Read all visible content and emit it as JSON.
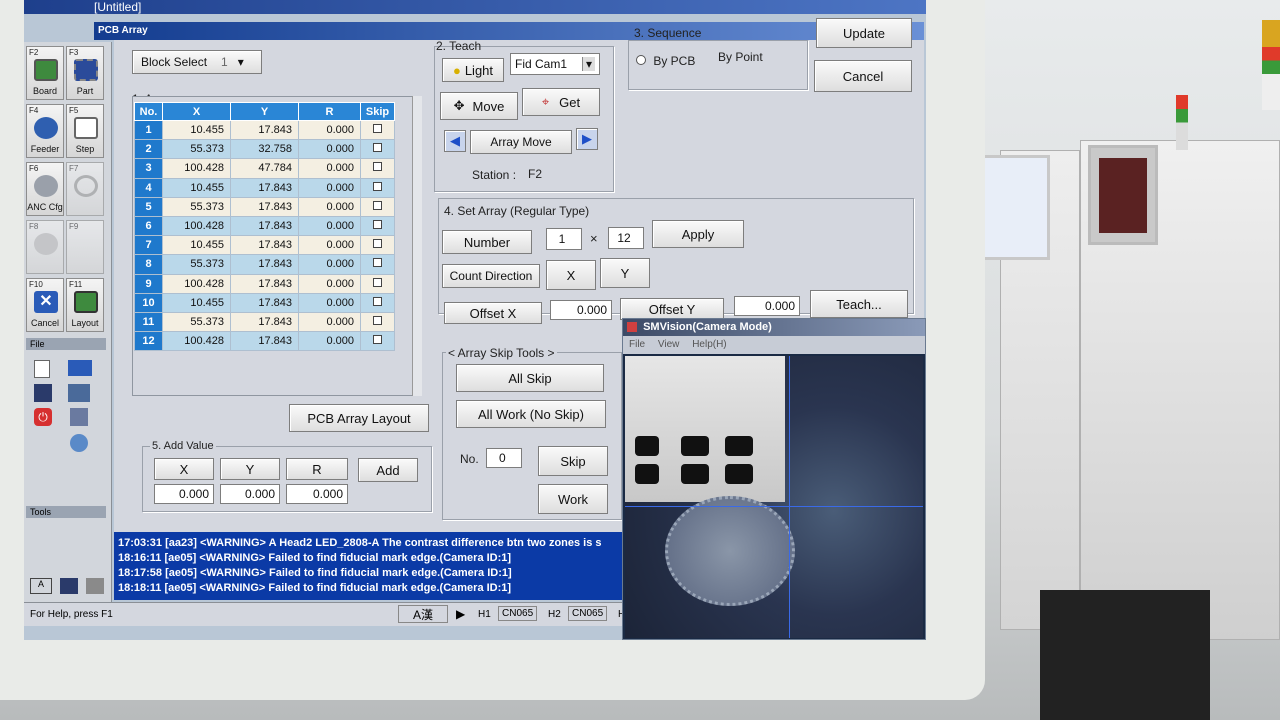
{
  "window": {
    "title": "[Untitled]",
    "dialog_title": "PCB Array"
  },
  "left_toolbar": {
    "buttons": [
      {
        "key": "F2",
        "label": "Board"
      },
      {
        "key": "F3",
        "label": "Part"
      },
      {
        "key": "F4",
        "label": "Feeder"
      },
      {
        "key": "F5",
        "label": "Step"
      },
      {
        "key": "F6",
        "label": "ANC Cfg"
      },
      {
        "key": "F7",
        "label": ""
      },
      {
        "key": "F8",
        "label": ""
      },
      {
        "key": "F9",
        "label": ""
      },
      {
        "key": "F10",
        "label": "Cancel"
      },
      {
        "key": "F11",
        "label": "Layout"
      }
    ],
    "file_header": "File",
    "tools_header": "Tools"
  },
  "array_section": {
    "block_select_label": "Block Select",
    "block_select_value": "1",
    "title": "1. Array",
    "columns": [
      "No.",
      "X",
      "Y",
      "R",
      "Skip"
    ],
    "rows": [
      {
        "no": "1",
        "x": "10.455",
        "y": "17.843",
        "r": "0.000"
      },
      {
        "no": "2",
        "x": "55.373",
        "y": "32.758",
        "r": "0.000"
      },
      {
        "no": "3",
        "x": "100.428",
        "y": "47.784",
        "r": "0.000"
      },
      {
        "no": "4",
        "x": "10.455",
        "y": "17.843",
        "r": "0.000"
      },
      {
        "no": "5",
        "x": "55.373",
        "y": "17.843",
        "r": "0.000"
      },
      {
        "no": "6",
        "x": "100.428",
        "y": "17.843",
        "r": "0.000"
      },
      {
        "no": "7",
        "x": "10.455",
        "y": "17.843",
        "r": "0.000"
      },
      {
        "no": "8",
        "x": "55.373",
        "y": "17.843",
        "r": "0.000"
      },
      {
        "no": "9",
        "x": "100.428",
        "y": "17.843",
        "r": "0.000"
      },
      {
        "no": "10",
        "x": "10.455",
        "y": "17.843",
        "r": "0.000"
      },
      {
        "no": "11",
        "x": "55.373",
        "y": "17.843",
        "r": "0.000"
      },
      {
        "no": "12",
        "x": "100.428",
        "y": "17.843",
        "r": "0.000"
      }
    ],
    "layout_button": "PCB Array Layout"
  },
  "teach": {
    "title": "2. Teach",
    "light_label": "Light",
    "camera_select": "Fid Cam1",
    "move_label": "Move",
    "get_label": "Get",
    "array_move_label": "Array Move",
    "station_label": "Station :",
    "station_value": "F2"
  },
  "sequence": {
    "title": "3. Sequence",
    "option1": "By PCB",
    "option2": "By Point",
    "update_label": "Update",
    "cancel_label": "Cancel"
  },
  "set_array": {
    "title": "4. Set Array (Regular Type)",
    "number_label": "Number",
    "number_x": "1",
    "times": "×",
    "number_y": "12",
    "apply_label": "Apply",
    "count_direction_label": "Count Direction",
    "dir_x": "X",
    "dir_y": "Y",
    "offset_x_label": "Offset X",
    "offset_x_value": "0.000",
    "offset_y_label": "Offset Y",
    "offset_y_value": "0.000",
    "teach_label": "Teach..."
  },
  "skip_tools": {
    "title": "< Array Skip Tools >",
    "all_skip": "All Skip",
    "all_work": "All Work (No Skip)",
    "no_label": "No.",
    "no_value": "0",
    "skip_label": "Skip",
    "work_label": "Work"
  },
  "add_value": {
    "title": "5. Add Value",
    "x_label": "X",
    "y_label": "Y",
    "r_label": "R",
    "add_label": "Add",
    "x_value": "0.000",
    "y_value": "0.000",
    "r_value": "0.000"
  },
  "log": {
    "lines": [
      "17:03:31 [aa23] <WARNING> A Head2 LED_2808-A The contrast difference btn two zones is s",
      "18:16:11 [ae05] <WARNING> Failed to find fiducial mark edge.(Camera ID:1]",
      "18:17:58 [ae05] <WARNING> Failed to find fiducial mark edge.(Camera ID:1]",
      "18:18:11 [ae05] <WARNING> Failed to find fiducial mark edge.(Camera ID:1]"
    ]
  },
  "status": {
    "help": "For Help, press F1",
    "h1": "H1",
    "h1_value": "CN065",
    "h2": "H2",
    "h2_value": "CN065",
    "h3": "H"
  },
  "camera_window": {
    "title": "SMVision(Camera Mode)",
    "menu": [
      "File",
      "View",
      "Help(H)"
    ]
  },
  "colors": {
    "grid_header": "#2a86d6",
    "log_bg": "#0b3aa6",
    "title_bar": "#133c8f"
  }
}
